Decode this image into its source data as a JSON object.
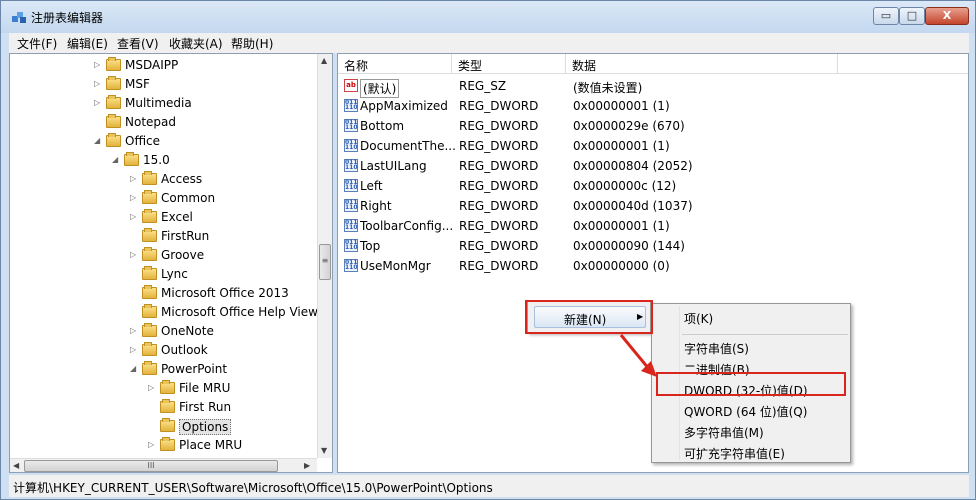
{
  "window": {
    "title": "注册表编辑器",
    "min": "▭",
    "max": "□",
    "close": "X"
  },
  "menubar": [
    "文件(F)",
    "编辑(E)",
    "查看(V)",
    "收藏夹(A)",
    "帮助(H)"
  ],
  "tree": [
    {
      "label": "MSDAIPP",
      "indent": 0,
      "expand": "collapsed"
    },
    {
      "label": "MSF",
      "indent": 0,
      "expand": "collapsed"
    },
    {
      "label": "Multimedia",
      "indent": 0,
      "expand": "collapsed"
    },
    {
      "label": "Notepad",
      "indent": 0,
      "expand": "none"
    },
    {
      "label": "Office",
      "indent": 0,
      "expand": "expanded"
    },
    {
      "label": "15.0",
      "indent": 1,
      "expand": "expanded"
    },
    {
      "label": "Access",
      "indent": 2,
      "expand": "collapsed"
    },
    {
      "label": "Common",
      "indent": 2,
      "expand": "collapsed"
    },
    {
      "label": "Excel",
      "indent": 2,
      "expand": "collapsed"
    },
    {
      "label": "FirstRun",
      "indent": 2,
      "expand": "none"
    },
    {
      "label": "Groove",
      "indent": 2,
      "expand": "collapsed"
    },
    {
      "label": "Lync",
      "indent": 2,
      "expand": "none"
    },
    {
      "label": "Microsoft Office 2013",
      "indent": 2,
      "expand": "none"
    },
    {
      "label": "Microsoft Office Help Viewe",
      "indent": 2,
      "expand": "none"
    },
    {
      "label": "OneNote",
      "indent": 2,
      "expand": "collapsed"
    },
    {
      "label": "Outlook",
      "indent": 2,
      "expand": "collapsed"
    },
    {
      "label": "PowerPoint",
      "indent": 2,
      "expand": "expanded"
    },
    {
      "label": "File MRU",
      "indent": 3,
      "expand": "collapsed"
    },
    {
      "label": "First Run",
      "indent": 3,
      "expand": "none"
    },
    {
      "label": "Options",
      "indent": 3,
      "expand": "none",
      "selected": true
    },
    {
      "label": "Place MRU",
      "indent": 3,
      "expand": "collapsed"
    }
  ],
  "tree_hscroll_grip": "III",
  "tree_vscroll_grip": "≡",
  "columns": {
    "name": "名称",
    "type": "类型",
    "data": "数据"
  },
  "values": [
    {
      "icon": "string-value-icon",
      "name": "(默认)",
      "type": "REG_SZ",
      "data": "(数值未设置)"
    },
    {
      "icon": "dword-value-icon",
      "name": "AppMaximized",
      "type": "REG_DWORD",
      "data": "0x00000001 (1)"
    },
    {
      "icon": "dword-value-icon",
      "name": "Bottom",
      "type": "REG_DWORD",
      "data": "0x0000029e (670)"
    },
    {
      "icon": "dword-value-icon",
      "name": "DocumentThe...",
      "type": "REG_DWORD",
      "data": "0x00000001 (1)"
    },
    {
      "icon": "dword-value-icon",
      "name": "LastUILang",
      "type": "REG_DWORD",
      "data": "0x00000804 (2052)"
    },
    {
      "icon": "dword-value-icon",
      "name": "Left",
      "type": "REG_DWORD",
      "data": "0x0000000c (12)"
    },
    {
      "icon": "dword-value-icon",
      "name": "Right",
      "type": "REG_DWORD",
      "data": "0x0000040d (1037)"
    },
    {
      "icon": "dword-value-icon",
      "name": "ToolbarConfig...",
      "type": "REG_DWORD",
      "data": "0x00000001 (1)"
    },
    {
      "icon": "dword-value-icon",
      "name": "Top",
      "type": "REG_DWORD",
      "data": "0x00000090 (144)"
    },
    {
      "icon": "dword-value-icon",
      "name": "UseMonMgr",
      "type": "REG_DWORD",
      "data": "0x00000000 (0)"
    }
  ],
  "context_menu": {
    "new_label": "新建(N)",
    "arrow": "▶"
  },
  "submenu": {
    "key": "项(K)",
    "items": [
      "字符串值(S)",
      "二进制值(B)",
      "DWORD (32-位)值(D)",
      "QWORD (64 位)值(Q)",
      "多字符串值(M)",
      "可扩充字符串值(E)"
    ]
  },
  "icons": {
    "ab": "ab",
    "dword": "011 110"
  },
  "status": "计算机\\HKEY_CURRENT_USER\\Software\\Microsoft\\Office\\15.0\\PowerPoint\\Options",
  "highlight_color": "#d9261c"
}
